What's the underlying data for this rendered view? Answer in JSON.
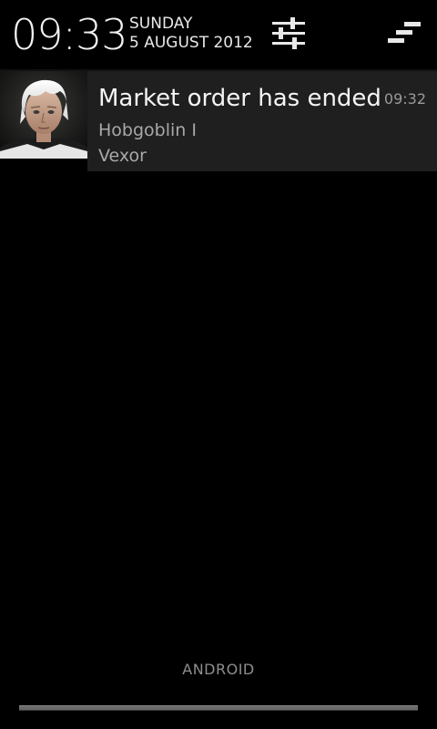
{
  "header": {
    "time": "09:33",
    "day": "SUNDAY",
    "date": "5 AUGUST 2012",
    "settings_icon": "settings-sliders-icon",
    "clear_icon": "clear-all-icon"
  },
  "notification": {
    "title": "Market order has ended",
    "time": "09:32",
    "line1": "Hobgoblin I",
    "line2": "Vexor",
    "avatar_icon": "character-portrait"
  },
  "footer": {
    "carrier": "ANDROID"
  },
  "colors": {
    "background": "#000000",
    "notification_bg": "#1f1f1f",
    "text_primary": "#f4f4f4",
    "text_secondary": "#a8a8a8"
  }
}
